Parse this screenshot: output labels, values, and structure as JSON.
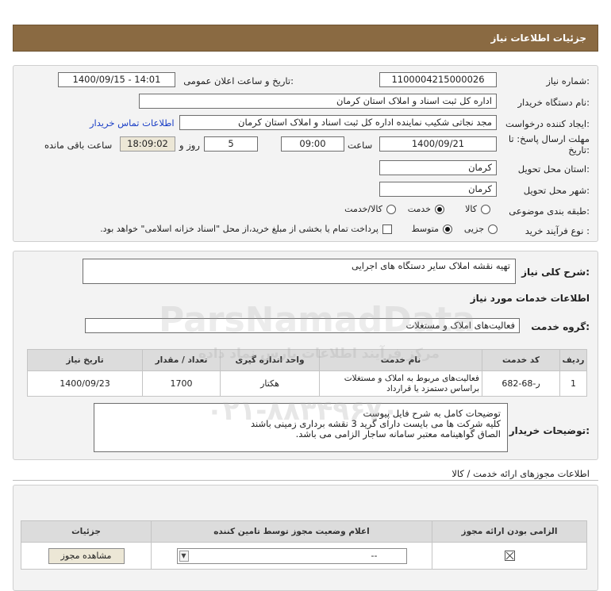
{
  "header": {
    "title": "جزئیات اطلاعات نیاز"
  },
  "form": {
    "need_number_label": "شماره نیاز:",
    "need_number": "1100004215000026",
    "announce_label": "تاریخ و ساعت اعلان عمومی:",
    "announce_value": "1400/09/15 - 14:01",
    "buyer_org_label": "نام دستگاه خریدار:",
    "buyer_org": "اداره کل ثبت اسناد و املاک استان کرمان",
    "requester_label": "ایجاد کننده درخواست:",
    "requester": "مجد نجاتی شکیب نماینده اداره کل ثبت اسناد و املاک استان کرمان",
    "contact_link": "اطلاعات تماس خریدار",
    "deadline_label_1": "مهلت ارسال پاسخ: تا",
    "deadline_label_2": "تاریخ:",
    "deadline_date": "1400/09/21",
    "time_label": "ساعت",
    "deadline_time": "09:00",
    "days_value": "5",
    "days_label": "روز و",
    "remaining_time": "18:09:02",
    "remaining_label": "ساعت باقی مانده",
    "province_label": "استان محل تحویل:",
    "province": "کرمان",
    "city_label": "شهر محل تحویل:",
    "city": "کرمان",
    "category_label": "طبقه بندی موضوعی:",
    "category_options": [
      "کالا",
      "خدمت",
      "کالا/خدمت"
    ],
    "process_label": "نوع فرآیند خرید :",
    "process_options": [
      "جزیی",
      "متوسط"
    ],
    "payment_note": "پرداخت تمام یا بخشی از مبلغ خرید،از محل \"اسناد خزانه اسلامی\" خواهد بود."
  },
  "summary": {
    "label": "شرح کلی نیاز:",
    "value": "تهیه نقشه املاک سایر دستگاه های اجرایی",
    "services_title": "اطلاعات خدمات مورد نیاز",
    "group_label": "گروه خدمت:",
    "group_value": "فعالیت‌های  املاک و مستغلات"
  },
  "table": {
    "headers": [
      "ردیف",
      "کد خدمت",
      "نام خدمت",
      "واحد اندازه گیری",
      "تعداد / مقدار",
      "تاریخ نیاز"
    ],
    "rows": [
      [
        "1",
        "ر-68-682",
        "فعالیت‌های مربوط به املاک و مستغلات براساس دستمزد یا قرارداد",
        "هکتار",
        "1700",
        "1400/09/23"
      ]
    ]
  },
  "buyer_notes": {
    "label": "توضیحات خریدار:",
    "lines": [
      "توضیحات کامل به شرح فایل پیوست",
      "کلیه شرکت ها می بایست دارای گرید 3 نقشه برداری زمینی باشند",
      "الصاق گواهینامه معتبر سامانه ساجار الزامی می باشد."
    ]
  },
  "permits": {
    "title": "اطلاعات مجوزهای ارائه خدمت / کالا",
    "headers": [
      "الزامی بودن ارائه مجوز",
      "اعلام وضعیت مجوز توسط تامین کننده",
      "جزئیات"
    ],
    "dropdown_value": "--",
    "view_button": "مشاهده مجوز"
  },
  "watermark": {
    "line1": "ParsNamadData",
    "line2": "مرکز فرآیند اطلاعات پارس نماد داده",
    "phone": "۰۲۱-۸۸۳۴۹۶۷۰"
  }
}
